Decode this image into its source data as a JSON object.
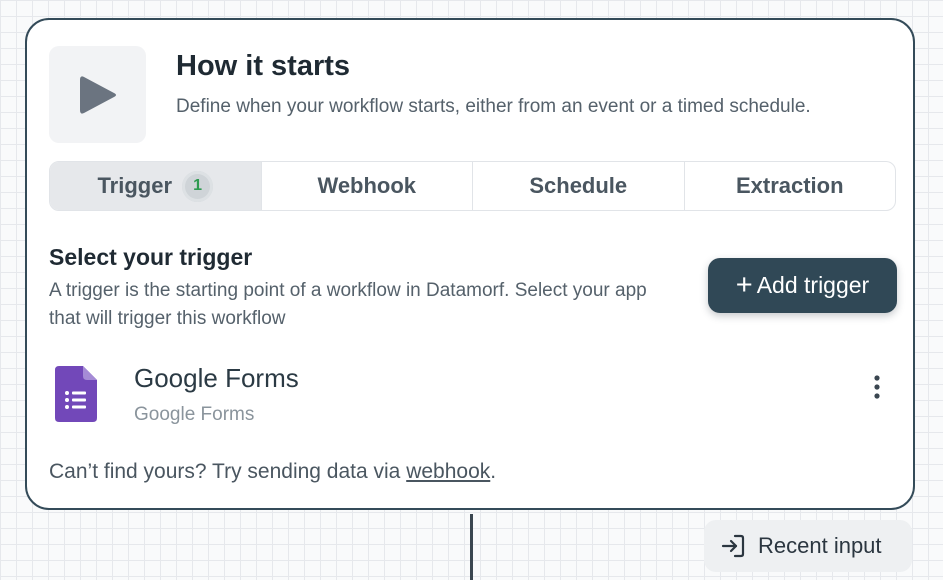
{
  "header": {
    "title": "How it starts",
    "description": "Define when your workflow starts, either from an event or a timed schedule.",
    "icon": "play-icon"
  },
  "tabs": [
    {
      "label": "Trigger",
      "badge": "1",
      "active": true
    },
    {
      "label": "Webhook",
      "active": false
    },
    {
      "label": "Schedule",
      "active": false
    },
    {
      "label": "Extraction",
      "active": false
    }
  ],
  "section": {
    "title": "Select your trigger",
    "description": "A trigger is the starting point of a workflow in Datamorf. Select your app that will trigger this workflow"
  },
  "add_button": {
    "label": "Add trigger",
    "icon": "plus-icon"
  },
  "trigger": {
    "name": "Google Forms",
    "subtitle": "Google Forms",
    "icon": "google-forms-icon",
    "menu_icon": "more-vertical-icon"
  },
  "footer": {
    "text": "Can’t find yours? Try sending data via ",
    "link": "webhook",
    "suffix": "."
  },
  "recent_input": {
    "label": "Recent input",
    "icon": "login-arrow-icon"
  },
  "colors": {
    "card_border": "#344b59",
    "button_bg": "#304856",
    "badge_text": "#2e9a50",
    "forms_purple": "#7248b9"
  }
}
